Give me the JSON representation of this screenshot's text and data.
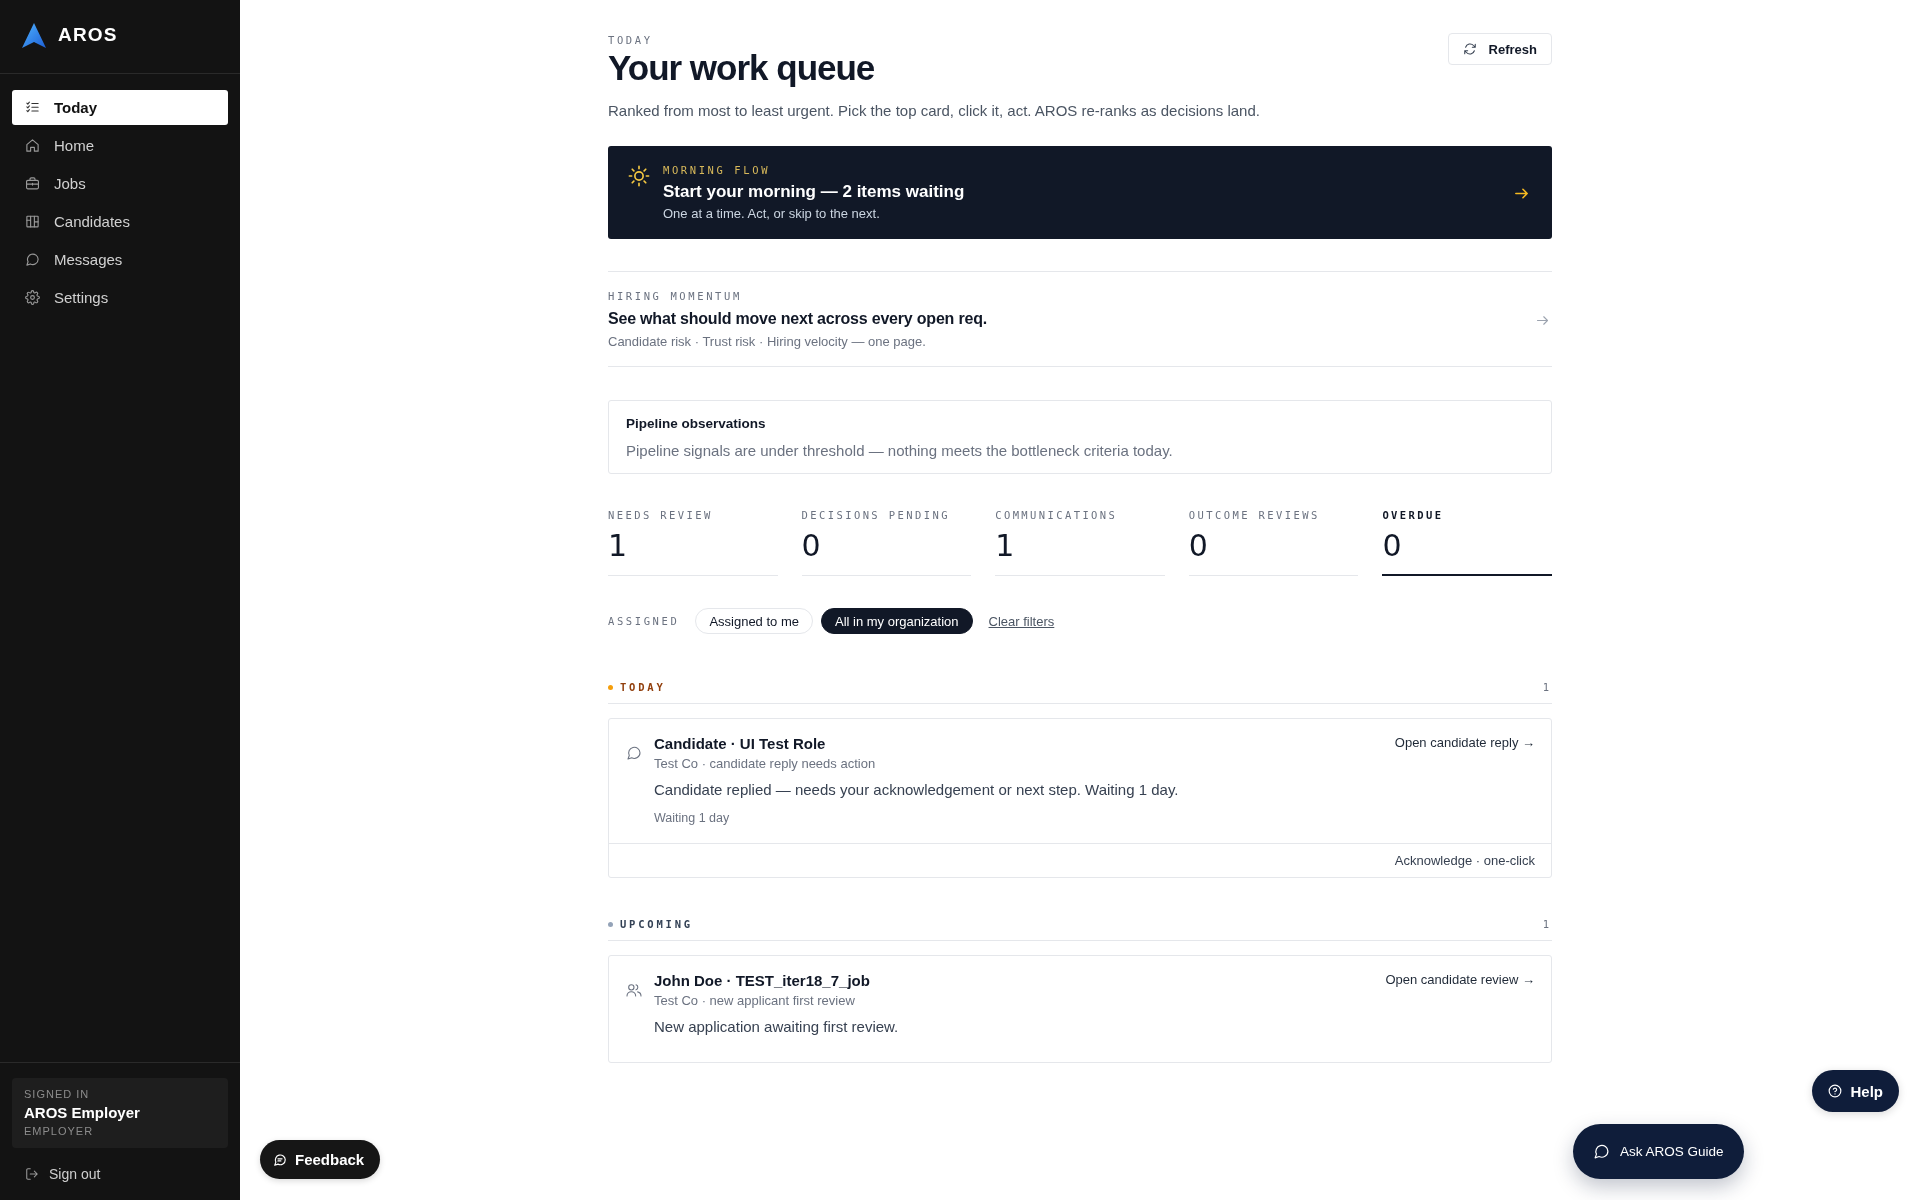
{
  "sidebar": {
    "brand": "AROS",
    "items": [
      {
        "label": "Today",
        "selected": true
      },
      {
        "label": "Home",
        "selected": false
      },
      {
        "label": "Jobs",
        "selected": false
      },
      {
        "label": "Candidates",
        "selected": false
      },
      {
        "label": "Messages",
        "selected": false
      },
      {
        "label": "Settings",
        "selected": false
      }
    ],
    "account": {
      "eyebrow": "SIGNED IN",
      "name": "AROS Employer",
      "role": "EMPLOYER"
    },
    "sign_out": "Sign out"
  },
  "header": {
    "eyebrow": "TODAY",
    "title": "Your work queue",
    "subtitle": "Ranked from most to least urgent. Pick the top card, click it, act. AROS re-ranks as decisions land.",
    "refresh": "Refresh"
  },
  "morning_flow": {
    "eyebrow": "MORNING FLOW",
    "title": "Start your morning — 2 items waiting",
    "subtitle": "One at a time. Act, or skip to the next."
  },
  "hiring_momentum": {
    "eyebrow": "HIRING MOMENTUM",
    "title": "See what should move next across every open req.",
    "subtitle": "Candidate risk · Trust risk · Hiring velocity — one page."
  },
  "pipeline_observations": {
    "title": "Pipeline observations",
    "text": "Pipeline signals are under threshold — nothing meets the bottleneck criteria today."
  },
  "stats": [
    {
      "label": "NEEDS REVIEW",
      "value": "1",
      "selected": false
    },
    {
      "label": "DECISIONS PENDING",
      "value": "0",
      "selected": false
    },
    {
      "label": "COMMUNICATIONS",
      "value": "1",
      "selected": false
    },
    {
      "label": "OUTCOME REVIEWS",
      "value": "0",
      "selected": false
    },
    {
      "label": "OVERDUE",
      "value": "0",
      "selected": true
    }
  ],
  "filters": {
    "label": "ASSIGNED",
    "options": [
      {
        "label": "Assigned to me",
        "selected": false
      },
      {
        "label": "All in my organization",
        "selected": true
      }
    ],
    "clear": "Clear filters"
  },
  "sections": [
    {
      "kind": "urgent",
      "title": "TODAY",
      "count": "1",
      "color": "#f59e0b",
      "items": [
        {
          "kind": "reply",
          "title": "Candidate · UI Test Role",
          "meta": "Test Co · candidate reply needs action",
          "description": "Candidate replied — needs your acknowledgement or next step. Waiting 1 day.",
          "waiting": "Waiting 1 day",
          "action": "Open candidate reply →",
          "footer_action": "Acknowledge · one-click"
        }
      ]
    },
    {
      "kind": "upcoming",
      "title": "UPCOMING",
      "count": "1",
      "color": "#94a3b8",
      "items": [
        {
          "kind": "review",
          "title": "John Doe · TEST_iter18_7_job",
          "meta": "Test Co · new applicant first review",
          "description": "New application awaiting first review.",
          "action": "Open candidate review →"
        }
      ]
    }
  ],
  "floating_buttons": {
    "feedback": "Feedback",
    "guide": "Ask AROS Guide",
    "help": "Help"
  }
}
